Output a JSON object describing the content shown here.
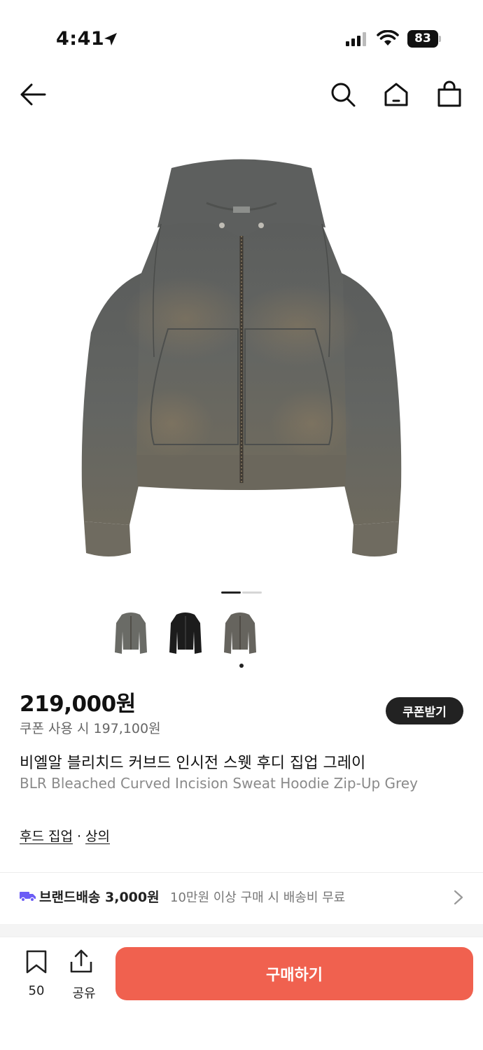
{
  "status_bar": {
    "time": "4:41",
    "battery": "83"
  },
  "carousel": {
    "active_index": 1,
    "count": 2
  },
  "thumbnails": [
    {
      "name": "grey-hoodie"
    },
    {
      "name": "black-hoodie"
    },
    {
      "name": "grey-hoodie-alt",
      "selected": true
    }
  ],
  "product": {
    "price": "219,000원",
    "coupon_price": "쿠폰 사용 시 197,100원",
    "coupon_button": "쿠폰받기",
    "title_ko": "비엘알 블리치드 커브드 인시전 스웻 후디 집업 그레이",
    "title_en": "BLR Bleached Curved Incision Sweat Hoodie Zip-Up Grey"
  },
  "categories": {
    "first": "후드 집업",
    "separator": "·",
    "second": "상의"
  },
  "shipping": {
    "label": "브랜드배송 3,000원",
    "note": "10만원 이상 구매 시 배송비 무료",
    "icon_color": "#6b5cf6"
  },
  "bottom_bar": {
    "bookmark_count": "50",
    "share_label": "공유",
    "buy_label": "구매하기",
    "buy_color": "#f0614f"
  }
}
